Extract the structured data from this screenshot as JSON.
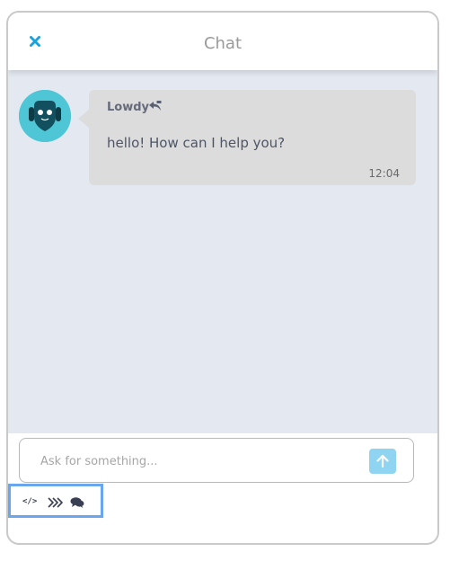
{
  "header": {
    "title": "Chat",
    "close_icon": "close-icon"
  },
  "messages": [
    {
      "sender": "Lowdy",
      "text": "hello! How can I help you?",
      "time": "12:04",
      "avatar_icon": "robot-avatar-icon",
      "action_icon": "reply-icon"
    }
  ],
  "composer": {
    "placeholder": "Ask for something...",
    "send_icon": "arrow-up-icon"
  },
  "toolbar": {
    "items": [
      {
        "icon": "code-icon",
        "glyph": "</>"
      },
      {
        "icon": "triple-chevron-right-icon"
      },
      {
        "icon": "chat-bubbles-icon"
      }
    ]
  },
  "colors": {
    "accent": "#1aa3d9",
    "chat_background": "#e4e8f0",
    "bubble": "#dcdcdc",
    "avatar_ring": "#4fc6d6",
    "send_button": "#8fd4f0",
    "highlight_border": "#6aa6ee"
  }
}
